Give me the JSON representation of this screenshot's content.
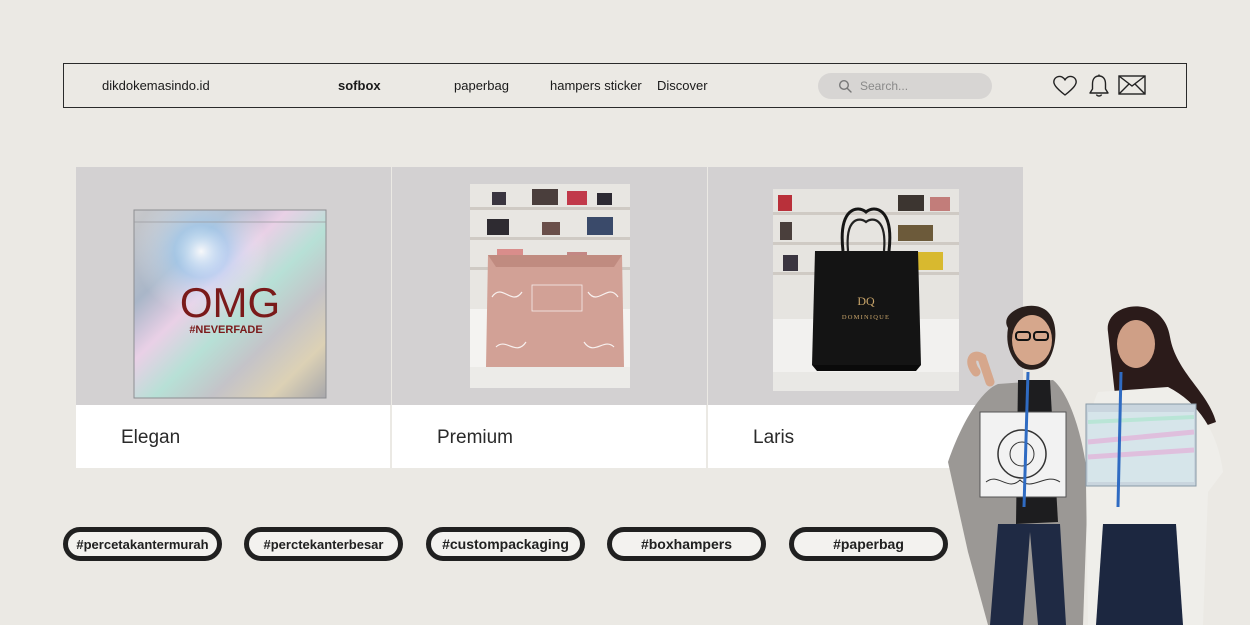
{
  "nav": {
    "brand": "dikdokemasindo.id",
    "links": [
      "sofbox",
      "paperbag",
      "hampers sticker",
      "Discover"
    ],
    "search_placeholder": "Search...",
    "icons": [
      "heart-icon",
      "bell-icon",
      "mail-icon"
    ]
  },
  "cards": [
    {
      "label": "Elegan",
      "image": "holographic-box-image",
      "logo_text": "OMG",
      "sub_text": "#NEVERFADE"
    },
    {
      "label": "Premium",
      "image": "pink-box-image"
    },
    {
      "label": "Laris",
      "image": "black-paperbag-image",
      "logo_text": "DOMINIQUE"
    }
  ],
  "tags": [
    "#percetakantermurah",
    "#perctekanterbesar",
    "#custompackaging",
    "#boxhampers",
    "#paperbag"
  ],
  "colors": {
    "background": "#ebe9e4",
    "card_image_bg": "#d3d1d2",
    "search_bg": "#d7d5d3",
    "tag_border": "#202020"
  }
}
